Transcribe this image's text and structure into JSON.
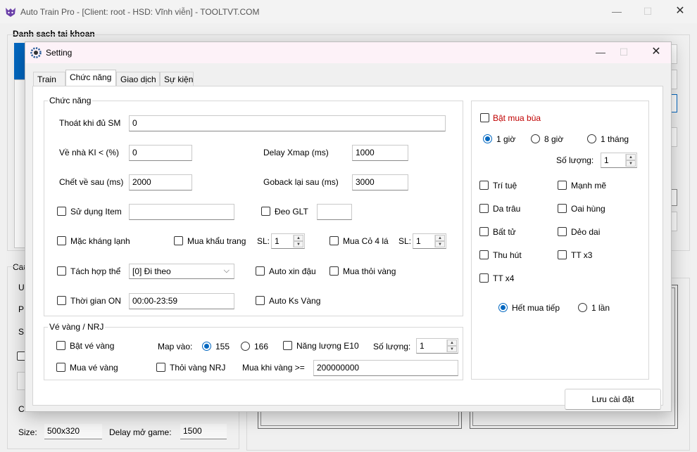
{
  "main": {
    "title": "Auto Train Pro - [Client: root - HSD: Vĩnh viễn] - TOOLTVT.COM",
    "accounts_label": "Danh sach tai khoan",
    "partial_label_ca": "Cau",
    "partial_label_u": "U",
    "partial_label_p": "P",
    "partial_label_s": "S",
    "partial_label_c": "C",
    "size_label": "Size:",
    "size_value": "500x320",
    "delay_label": "Delay mở game:",
    "delay_value": "1500"
  },
  "dialog": {
    "title": "Setting",
    "tabs": [
      "Train",
      "Chức năng",
      "Giao dịch",
      "Sự kiện"
    ],
    "active_tab": "Chức năng",
    "save_button": "Lưu cài đặt"
  },
  "features": {
    "group_label": "Chức năng",
    "exit_sm_label": "Thoát khi đủ SM",
    "exit_sm_value": "0",
    "home_ki_label": "Về nhà KI < (%)",
    "home_ki_value": "0",
    "delay_xmap_label": "Delay Xmap (ms)",
    "delay_xmap_value": "1000",
    "dead_home_label": "Chết về sau (ms)",
    "dead_home_value": "2000",
    "goback_label": "Goback lại sau (ms)",
    "goback_value": "3000",
    "use_item_label": "Sử dụng Item",
    "use_item_value": "",
    "wear_glt_label": "Đeo GLT",
    "wear_glt_value": "",
    "cold_resist_label": "Mặc kháng lạnh",
    "buy_mask_label": "Mua khẩu trang",
    "sl_label": "SL:",
    "buy_mask_qty": "1",
    "buy_clover_label": "Mua Cỏ 4 lá",
    "buy_clover_qty": "1",
    "split_label": "Tách hợp thể",
    "split_value": "[0] Đi theo",
    "auto_bean_label": "Auto xin đậu",
    "buy_gold_bar_label": "Mua thỏi vàng",
    "time_on_label": "Thời gian ON",
    "time_on_value": "00:00-23:59",
    "auto_ks_label": "Auto Ks Vàng"
  },
  "ticket": {
    "group_label": "Vé vàng / NRJ",
    "enable_label": "Bật vé vàng",
    "map_label": "Map vào:",
    "map_155": "155",
    "map_166": "166",
    "energy_label": "Năng lượng E10",
    "qty_label": "Số lượng:",
    "qty_value": "1",
    "buy_ticket_label": "Mua vé vàng",
    "gold_nrj_label": "Thỏi vàng NRJ",
    "buy_when_label": "Mua khi vàng >=",
    "buy_when_value": "200000000"
  },
  "charm": {
    "enable_label": "Bật mua bùa",
    "one_hour": "1 giờ",
    "eight_hours": "8 giờ",
    "one_month": "1 tháng",
    "qty_label": "Số lượng:",
    "qty_value": "1",
    "items": [
      "Trí tuệ",
      "Mạnh mẽ",
      "Da trâu",
      "Oai hùng",
      "Bất tử",
      "Dẻo dai",
      "Thu hút",
      "TT x3",
      "TT x4"
    ],
    "continue_label": "Hết mua tiếp",
    "once_label": "1 lần"
  },
  "colors": {
    "accent": "#0067c0",
    "warning": "#c00000"
  }
}
